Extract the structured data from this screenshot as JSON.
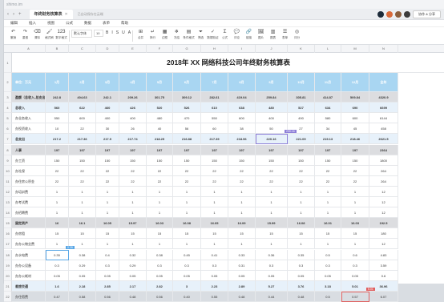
{
  "app": {
    "logo": "shimo.im"
  },
  "tab": {
    "title": "年终财务核算表",
    "autosave": "已自动保存在云端",
    "close": "✕"
  },
  "nav": {
    "back": "‹",
    "forward": "›",
    "add": "+"
  },
  "share_label": "协作 & 分享",
  "menus": [
    "编辑",
    "插入",
    "视图",
    "公式",
    "数据",
    "表单",
    "帮助"
  ],
  "toolbar": [
    {
      "icon": "undo-icon",
      "glyph": "↶",
      "label": "撤销"
    },
    {
      "icon": "redo-icon",
      "glyph": "↷",
      "label": "重做"
    },
    {
      "icon": "clear-icon",
      "glyph": "⌫",
      "label": "清除"
    },
    {
      "icon": "brush-icon",
      "glyph": "🖌",
      "label": "格式刷"
    },
    {
      "icon": "number-format-icon",
      "glyph": "123",
      "label": "数字格式"
    }
  ],
  "toolbar_right": [
    {
      "icon": "merge-icon",
      "glyph": "⊞",
      "label": "合并"
    },
    {
      "icon": "wrap-icon",
      "glyph": "↵",
      "label": "换行"
    },
    {
      "icon": "border-icon",
      "glyph": "▦",
      "label": "边框"
    },
    {
      "icon": "freeze-icon",
      "glyph": "❄",
      "label": "冻结"
    },
    {
      "icon": "cond-format-icon",
      "glyph": "▤",
      "label": "条件格式"
    },
    {
      "icon": "filter-icon",
      "glyph": "⏷",
      "label": "筛选"
    },
    {
      "icon": "validation-icon",
      "glyph": "✓",
      "label": "数据验证"
    },
    {
      "icon": "formula-icon",
      "glyph": "Σ",
      "label": "公式"
    },
    {
      "icon": "comment-icon",
      "glyph": "💬",
      "label": "评论"
    },
    {
      "icon": "link-icon",
      "glyph": "🔗",
      "label": "链接"
    },
    {
      "icon": "image-icon",
      "glyph": "🖼",
      "label": "图片"
    },
    {
      "icon": "chart-icon",
      "glyph": "▥",
      "label": "图表"
    },
    {
      "icon": "form-icon",
      "glyph": "☰",
      "label": "表单"
    },
    {
      "icon": "review-icon",
      "glyph": "◎",
      "label": "评分"
    }
  ],
  "font": {
    "family": "默认字体",
    "size": "10"
  },
  "format_buttons": [
    "B",
    "I",
    "S",
    "U",
    "A"
  ],
  "columns": [
    "A",
    "B",
    "C",
    "D",
    "E",
    "F",
    "G",
    "H",
    "I",
    "J",
    "K",
    "L",
    "M",
    "N"
  ],
  "sheet": {
    "title": "2018年 XX 网络科技公司年终财务核算表",
    "header": [
      "单位：万元",
      "1月",
      "2月",
      "3月",
      "4月",
      "5月",
      "6月",
      "7月",
      "8月",
      "9月",
      "10月",
      "11月",
      "12月",
      "全年"
    ],
    "rows": [
      {
        "n": "3",
        "style": "grey",
        "cells": [
          "盈额（总收入-总支出）",
          "242.8",
          "404.63",
          "242.1",
          "209.26",
          "301.75",
          "309.12",
          "282.61",
          "419.04",
          "259.84",
          "305.81",
          "414.87",
          "509.84",
          "4320.9"
        ]
      },
      {
        "n": "4",
        "style": "blue",
        "cells": [
          "总收入",
          "560",
          "622",
          "460",
          "426",
          "520",
          "526",
          "610",
          "638",
          "480",
          "527",
          "634",
          "690",
          "6699"
        ]
      },
      {
        "n": "5",
        "style": "",
        "cells": [
          "办业务收入",
          "550",
          "600",
          "400",
          "400",
          "480",
          "470",
          "550",
          "600",
          "400",
          "490",
          "580",
          "600",
          "6144"
        ]
      },
      {
        "n": "6",
        "style": "",
        "cells": [
          "办投资收入",
          "10",
          "22",
          "30",
          "26",
          "40",
          "56",
          "60",
          "38",
          "50",
          "27",
          "34",
          "45",
          "458"
        ]
      },
      {
        "n": "7",
        "style": "blue",
        "cells": [
          "总支出",
          "217.2",
          "217.36",
          "217.9",
          "217.74",
          "218.25",
          "216.88",
          "217.39",
          "218.96",
          "220.16",
          "221.09",
          "219.13",
          "218.46",
          "2621.5"
        ]
      },
      {
        "n": "8",
        "style": "grey",
        "cells": [
          "人事",
          "197",
          "197",
          "197",
          "197",
          "197",
          "197",
          "197",
          "197",
          "197",
          "197",
          "197",
          "197",
          "2364"
        ]
      },
      {
        "n": "9",
        "style": "",
        "cells": [
          "办工资",
          "150",
          "150",
          "150",
          "150",
          "150",
          "150",
          "150",
          "150",
          "150",
          "150",
          "150",
          "150",
          "1800"
        ]
      },
      {
        "n": "10",
        "style": "",
        "cells": [
          "办社保",
          "22",
          "22",
          "22",
          "22",
          "22",
          "22",
          "22",
          "22",
          "22",
          "22",
          "22",
          "22",
          "264"
        ]
      },
      {
        "n": "11",
        "style": "",
        "cells": [
          "办住房公积金",
          "22",
          "22",
          "22",
          "22",
          "22",
          "22",
          "22",
          "22",
          "22",
          "22",
          "22",
          "22",
          "264"
        ]
      },
      {
        "n": "12",
        "style": "",
        "cells": [
          "办培训费",
          "1",
          "1",
          "1",
          "1",
          "1",
          "1",
          "1",
          "1",
          "1",
          "1",
          "1",
          "1",
          "12"
        ]
      },
      {
        "n": "13",
        "style": "",
        "cells": [
          "办考试费",
          "1",
          "1",
          "1",
          "1",
          "1",
          "1",
          "1",
          "1",
          "1",
          "1",
          "1",
          "1",
          "12"
        ]
      },
      {
        "n": "14",
        "style": "",
        "cells": [
          "办招聘费",
          "1",
          "1",
          "1",
          "1",
          "1",
          "1",
          "1",
          "1",
          "1",
          "1",
          "1",
          "1",
          "12"
        ]
      },
      {
        "n": "15",
        "style": "grey",
        "cells": [
          "固定资产",
          "16",
          "16.1",
          "16.05",
          "15.97",
          "16.03",
          "16.08",
          "16.05",
          "16.09",
          "15.99",
          "16.08",
          "16.01",
          "16.03",
          "192.5"
        ]
      },
      {
        "n": "16",
        "style": "",
        "cells": [
          "办房租",
          "15",
          "15",
          "15",
          "15",
          "15",
          "15",
          "15",
          "15",
          "15",
          "15",
          "15",
          "15",
          "180"
        ]
      },
      {
        "n": "17",
        "style": "",
        "cells": [
          "办办公物业费",
          "1",
          "1",
          "1",
          "1",
          "1",
          "1",
          "1",
          "1",
          "1",
          "1",
          "1",
          "1",
          "12"
        ]
      },
      {
        "n": "18",
        "style": "",
        "cells": [
          "办水电费",
          "0.35",
          "0.38",
          "0.4",
          "0.32",
          "0.38",
          "0.45",
          "0.41",
          "0.33",
          "0.36",
          "0.35",
          "0.5",
          "0.6",
          "4.83"
        ]
      },
      {
        "n": "19",
        "style": "",
        "cells": [
          "办办公设备",
          "0.3",
          "0.29",
          "0.3",
          "0.29",
          "0.3",
          "0.3",
          "0.3",
          "0.31",
          "0.3",
          "0.3",
          "0.3",
          "0.3",
          "3.59"
        ]
      },
      {
        "n": "20",
        "style": "",
        "cells": [
          "办办公耗材",
          "0.05",
          "0.05",
          "0.05",
          "0.05",
          "0.05",
          "0.05",
          "0.05",
          "0.05",
          "0.05",
          "0.05",
          "0.05",
          "0.05",
          "0.6"
        ]
      },
      {
        "n": "21",
        "style": "blue",
        "cells": [
          "差旅交通",
          "1.6",
          "2.18",
          "2.85",
          "2.17",
          "2.82",
          "3",
          "2.23",
          "2.89",
          "5.27",
          "3.76",
          "3.18",
          "5.01",
          "36.96"
        ]
      },
      {
        "n": "22",
        "style": "",
        "cells": [
          "办住宿费",
          "0.47",
          "0.58",
          "0.56",
          "0.48",
          "0.56",
          "0.40",
          "0.55",
          "0.48",
          "0.44",
          "0.48",
          "0.5",
          "0.57",
          "6.07"
        ]
      }
    ]
  },
  "annotations": {
    "sel_badge_1": "0.35",
    "sel_badge_2": "230.16",
    "red_badge": "5.01"
  }
}
